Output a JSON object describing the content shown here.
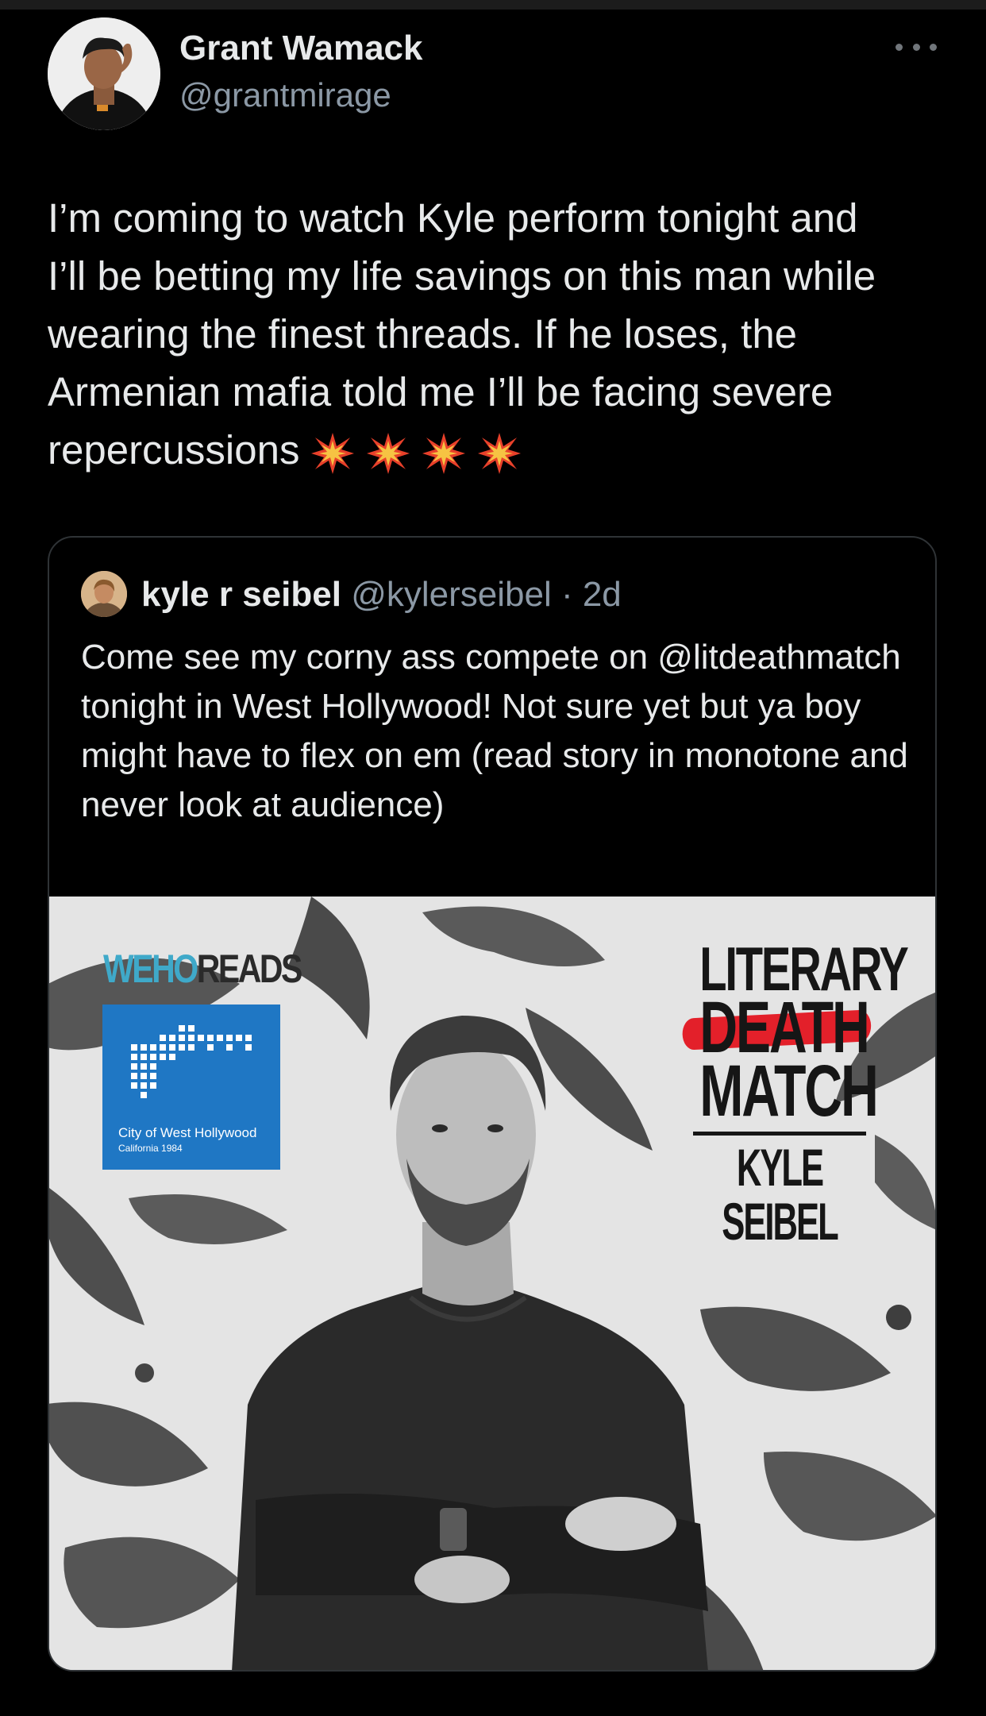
{
  "tweet": {
    "author": {
      "name": "Grant Wamack",
      "handle": "@grantmirage"
    },
    "text": "I’m coming to watch Kyle perform tonight and\nI’ll be betting my life savings on this man while\nwearing the finest threads. If he loses, the\nArmenian mafia told me I’ll be facing severe\nrepercussions",
    "emojis": [
      "💥",
      "💥",
      "💥",
      "💥"
    ],
    "more_icon": "more-horizontal-icon"
  },
  "quote": {
    "author": {
      "name": "kyle r seibel",
      "handle": "@kylerseibel",
      "separator": " · ",
      "time": "2d"
    },
    "text": "Come see my corny ass compete on @litdeathmatch tonight in West Hollywood! Not sure yet but ya boy might have to flex on em (read story in monotone and never look at audience)",
    "media": {
      "brand_a": "WEHO",
      "brand_b": "READS",
      "city_name": "City of West Hollywood",
      "city_year": "California 1984",
      "event_line1": "LITERARY",
      "event_line2": "DEATH",
      "event_line3": "MATCH",
      "event_performer": "KYLE SEIBEL"
    }
  },
  "colors": {
    "background": "#000000",
    "text_primary": "#e7e9ea",
    "text_secondary": "#8b98a5",
    "border": "#2f3336",
    "city_logo_blue": "#1f77c4",
    "accent_red": "#e3202a"
  }
}
